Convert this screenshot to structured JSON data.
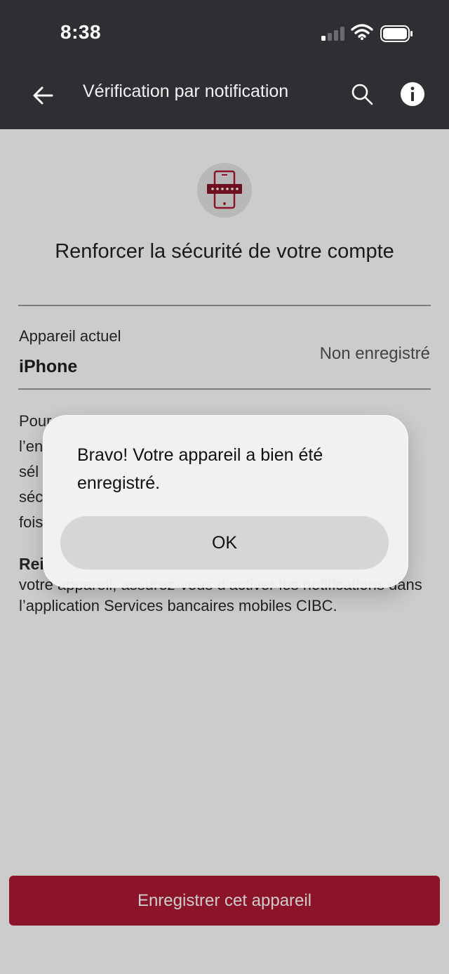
{
  "status_bar": {
    "time": "8:38"
  },
  "app_bar": {
    "title": "Vérification par notification"
  },
  "content": {
    "headline": "Renforcer la sécurité de votre compte",
    "device": {
      "label": "Appareil actuel",
      "name": "iPhone",
      "status": "Non enregistré"
    },
    "body_lines": [
      "Pour",
      "l’en",
      "sél",
      "séc",
      "fois"
    ],
    "reminder_bold": "Rei",
    "reminder_text": "votre appareil, assurez-vous d’activer les notifications dans l’application Services bancaires mobiles CIBC.",
    "primary_button": "Enregistrer cet appareil"
  },
  "dialog": {
    "message": "Bravo! Votre appareil a bien été enregistré.",
    "ok": "OK"
  },
  "colors": {
    "app_bar": "#2e2f33",
    "brand_red": "#b01a32",
    "dialog_bg": "#f2f2f2"
  },
  "icons": {
    "signal": "cellular-signal-icon",
    "wifi": "wifi-icon",
    "battery": "battery-icon",
    "back": "arrow-left-icon",
    "search": "search-icon",
    "info": "info-icon",
    "hero": "phone-passcode-icon"
  }
}
